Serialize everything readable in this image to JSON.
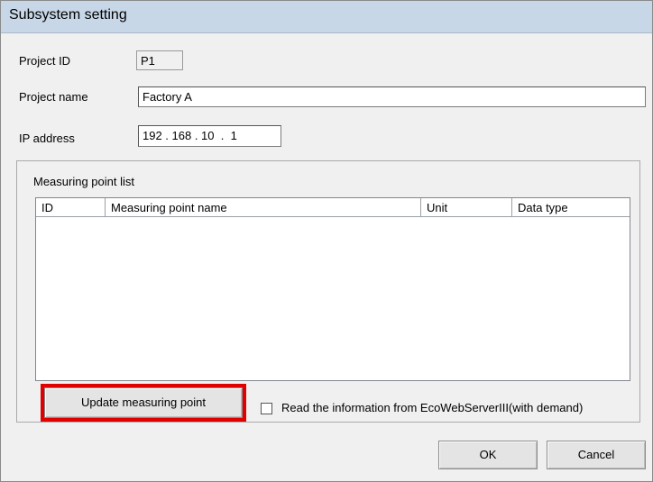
{
  "window": {
    "title": "Subsystem setting"
  },
  "form": {
    "project_id_label": "Project ID",
    "project_id_value": "P1",
    "project_name_label": "Project name",
    "project_name_value": "Factory A",
    "ip_label": "IP address",
    "ip_value": "192 . 168 . 10  .  1"
  },
  "measuring_points": {
    "group_label": "Measuring point list",
    "columns": [
      "ID",
      "Measuring point name",
      "Unit",
      "Data type"
    ],
    "rows": []
  },
  "actions": {
    "update_label": "Update measuring point",
    "read_info_label": "Read the information from EcoWebServerIII(with demand)",
    "read_info_checked": false,
    "ok_label": "OK",
    "cancel_label": "Cancel"
  },
  "colors": {
    "highlight": "#e00000",
    "titlebar": "#c7d7e7",
    "dialog_bg": "#f0f0f0"
  }
}
